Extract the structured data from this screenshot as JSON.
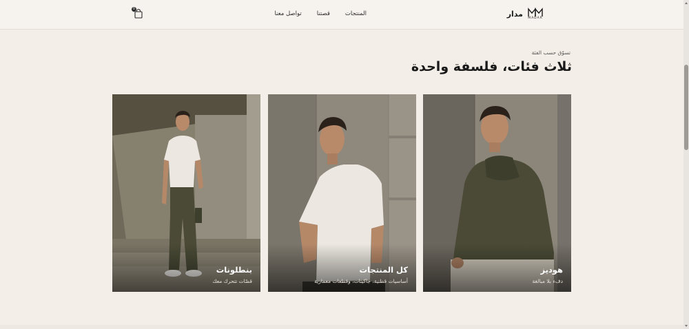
{
  "header": {
    "brand_name": "مدار",
    "brand_caption": "MADAR",
    "nav": [
      "المنتجات",
      "قصتنا",
      "تواصل معنا"
    ],
    "cart_icon": "shopping-bag-icon",
    "cart_count": "0"
  },
  "section": {
    "eyebrow": "تسوّق حسب الفئة",
    "title": "ثلاث فئات، فلسفة واحدة"
  },
  "categories": [
    {
      "title": "هوديز",
      "subtitle": "دفء بلا مبالغة"
    },
    {
      "title": "كل المنتجات",
      "subtitle": "أساسيات قطنية، جاكيتات، وقطعات معمارية"
    },
    {
      "title": "بنطلونات",
      "subtitle": "قصّات تتحرك معك"
    }
  ],
  "colors": {
    "background": "#f3efe8",
    "text": "#1c1c1c",
    "concrete": "#8a8478",
    "olive": "#4a4a36"
  }
}
